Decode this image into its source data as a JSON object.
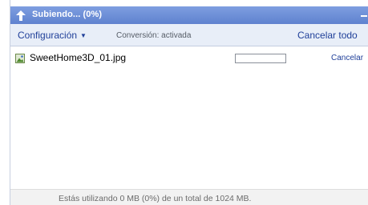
{
  "window": {
    "title": "Subiendo... (0%)"
  },
  "toolbar": {
    "config_label": "Configuración",
    "config_caret": "▼",
    "conversion_status": "Conversión: activada",
    "cancel_all_label": "Cancelar todo"
  },
  "files": [
    {
      "name": "SweetHome3D_01.jpg",
      "progress_percent": 0,
      "cancel_label": "Cancelar"
    }
  ],
  "footer": {
    "quota_text": "Estás utilizando 0 MB (0%) de un total de 1024 MB."
  },
  "colors": {
    "titlebar": "#6d8fd6",
    "toolbar_bg": "#e8eef8",
    "link": "#1f3f99"
  },
  "icons": {
    "title": "upload-arrow-icon",
    "file": "image-file-icon",
    "minimize": "minimize-icon"
  }
}
